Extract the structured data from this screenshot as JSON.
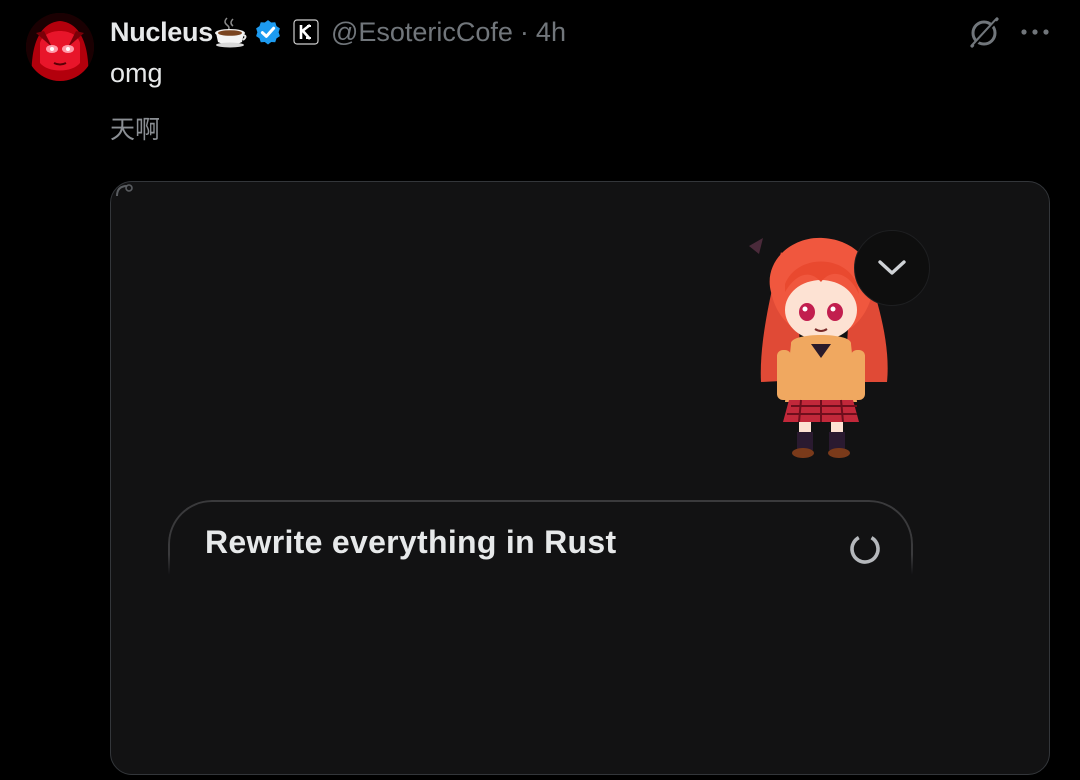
{
  "post": {
    "author": {
      "display_name": "Nucleus",
      "name_emoji_icon": "coffee-cup-icon",
      "verified_icon": "verified-badge-icon",
      "affiliate_icon": "affiliate-badge-icon",
      "handle": "@EsotericCofe",
      "separator": "·",
      "timestamp": "4h"
    },
    "actions": {
      "grok_icon": "grok-icon",
      "more_icon": "more-options-icon"
    },
    "text": "omg",
    "translation": "天啊",
    "media": {
      "prompt_text": "Rewrite everything in Rust",
      "spinner_icon": "loading-spinner-icon",
      "dropdown_icon": "chevron-down-icon"
    }
  },
  "colors": {
    "background": "#000000",
    "media_background": "#121213",
    "primary_text": "#e7e9ea",
    "secondary_text": "#71767b",
    "verified_blue": "#1d9bf0",
    "card_border": "#33363a"
  }
}
